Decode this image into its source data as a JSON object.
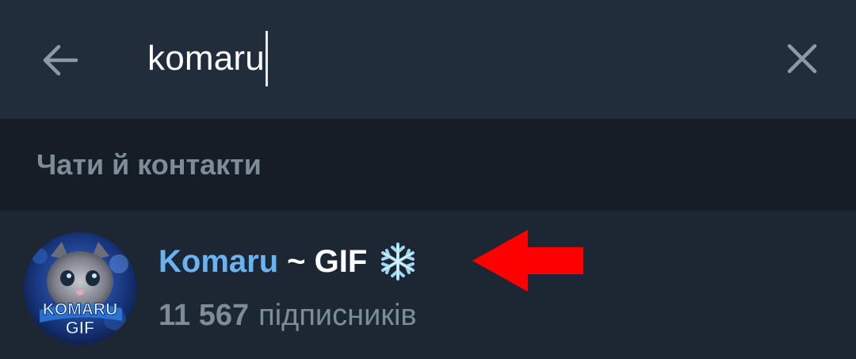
{
  "search": {
    "query": "komaru",
    "back_icon": "arrow-left-icon",
    "clear_icon": "close-icon"
  },
  "section": {
    "title": "Чати й контакти"
  },
  "result": {
    "title_match": "Komaru",
    "title_rest": "~ GIF",
    "emoji_icon": "snowflake-icon",
    "subscribers_count": "11 567",
    "subscribers_label": "підписників",
    "avatar_text": "KOMARU GIF"
  },
  "annotation": {
    "arrow_icon": "red-arrow-left-icon",
    "color": "#ff0000"
  },
  "colors": {
    "search_bar": "#212d3b",
    "section_bg": "#151e27",
    "list_bg": "#1d2733",
    "accent": "#6ab3f3",
    "muted_text": "#7f8b96"
  }
}
